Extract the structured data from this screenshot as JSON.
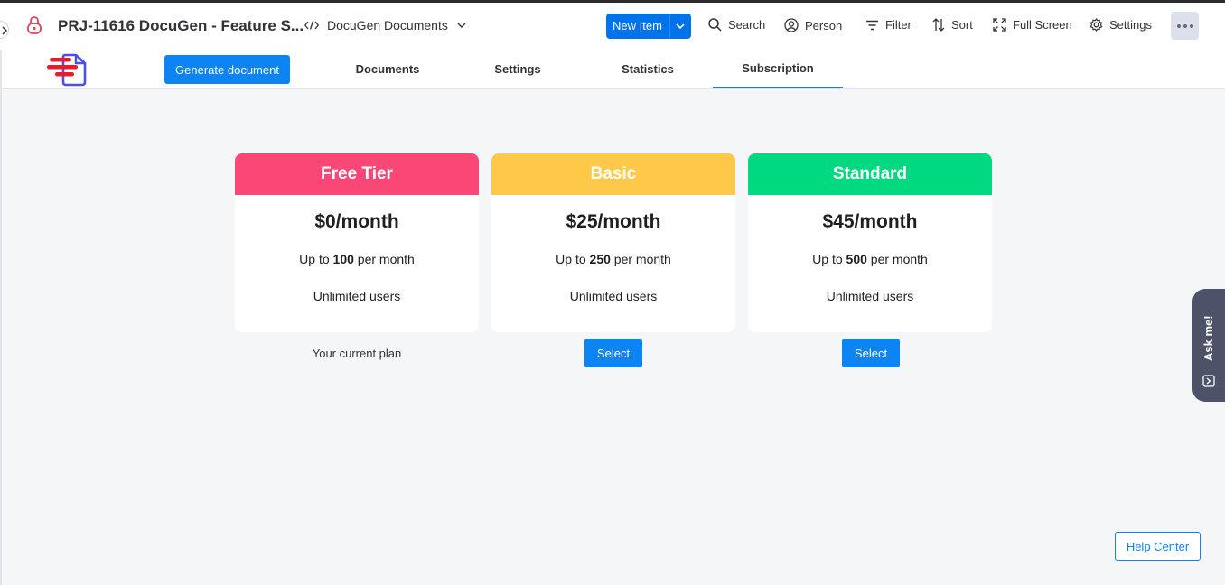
{
  "header": {
    "board_title": "PRJ-11616 DocuGen - Feature S...",
    "view_name": "DocuGen Documents",
    "new_item_label": "New Item",
    "tools": {
      "search": "Search",
      "person": "Person",
      "filter": "Filter",
      "sort": "Sort",
      "full_screen": "Full Screen",
      "settings": "Settings"
    }
  },
  "nav": {
    "generate_label": "Generate document",
    "tabs": [
      {
        "label": "Documents"
      },
      {
        "label": "Settings"
      },
      {
        "label": "Statistics"
      },
      {
        "label": "Subscription"
      }
    ],
    "active_tab": "Subscription"
  },
  "plans": [
    {
      "name": "Free Tier",
      "price": "$0/month",
      "limit_prefix": "Up to",
      "limit_value": "100",
      "limit_suffix": "per month",
      "users": "Unlimited users",
      "color": "#fb4776",
      "footer": "Your current plan"
    },
    {
      "name": "Basic",
      "price": "$25/month",
      "limit_prefix": "Up to",
      "limit_value": "250",
      "limit_suffix": "per month",
      "users": "Unlimited users",
      "color": "#fec948",
      "footer": "Select"
    },
    {
      "name": "Standard",
      "price": "$45/month",
      "limit_prefix": "Up to",
      "limit_value": "500",
      "limit_suffix": "per month",
      "users": "Unlimited users",
      "color": "#00d97f",
      "footer": "Select"
    }
  ],
  "ask_me_label": "Ask me!",
  "help_center_label": "Help Center",
  "colors": {
    "accent": "#0d84f3",
    "primary_button": "#0073ea"
  }
}
